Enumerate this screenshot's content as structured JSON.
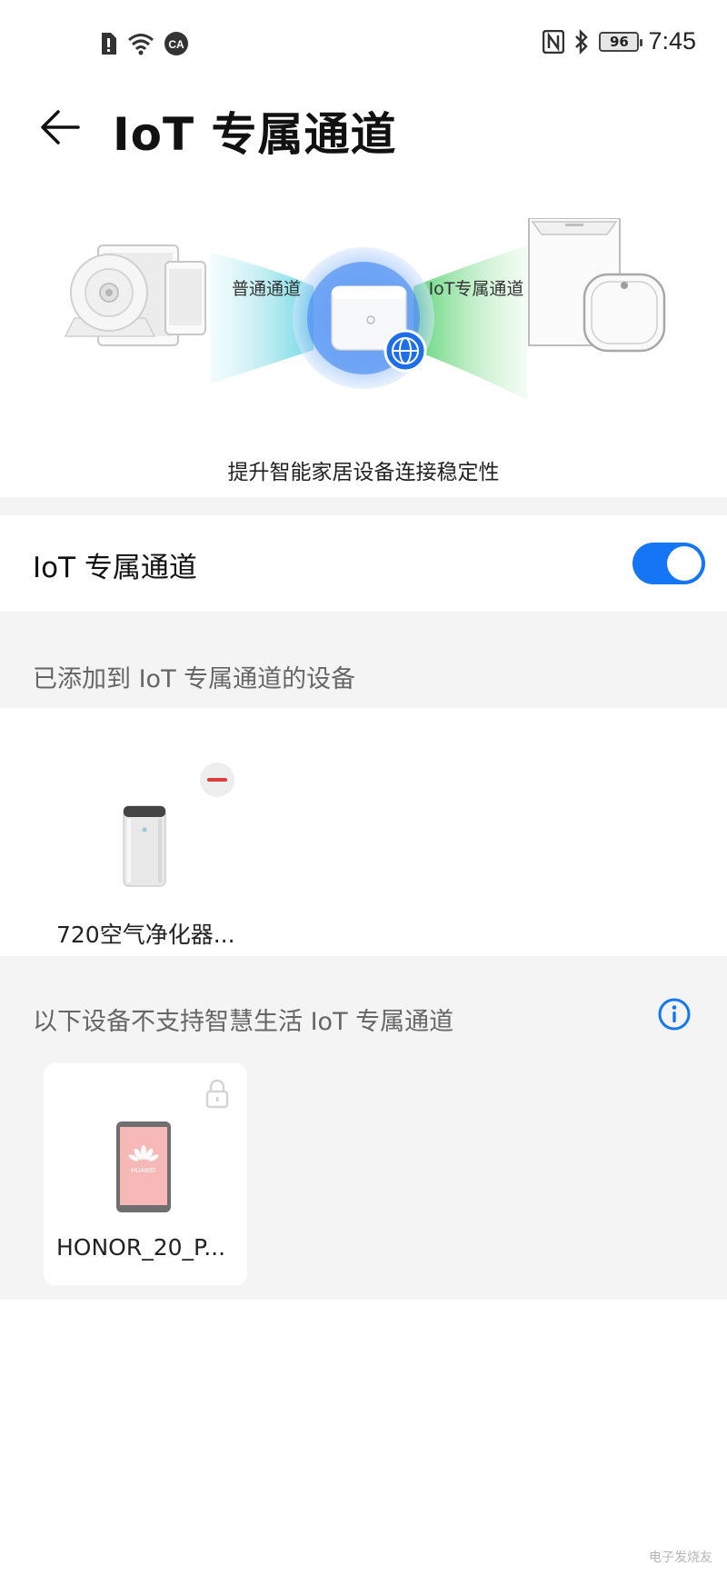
{
  "status_bar": {
    "time": "7:45",
    "battery": "96",
    "left_icons": [
      "sim-alert-icon",
      "wifi-icon",
      "ca-icon"
    ],
    "right_icons": [
      "nfc-icon",
      "bluetooth-icon",
      "battery-icon"
    ]
  },
  "header": {
    "title": "IoT 专属通道",
    "back_icon": "arrow-left-icon"
  },
  "hero": {
    "left_label": "普通通道",
    "right_label": "IoT专属通道",
    "caption": "提升智能家居设备连接稳定性"
  },
  "toggle": {
    "label": "IoT 专属通道",
    "enabled": true,
    "accent_color": "#1476f5"
  },
  "added_section": {
    "header": "已添加到 IoT 专属通道的设备",
    "devices": [
      {
        "name": "720空气净化器...",
        "icon": "air-purifier-icon",
        "action_icon": "remove-icon"
      }
    ]
  },
  "unsupported_section": {
    "header": "以下设备不支持智慧生活 IoT 专属通道",
    "info_icon": "info-icon",
    "devices": [
      {
        "name": "HONOR_20_P...",
        "icon": "phone-icon",
        "badge_icon": "lock-icon",
        "screen_logo": "HUAWEI"
      }
    ]
  },
  "watermark": "电子发烧友"
}
